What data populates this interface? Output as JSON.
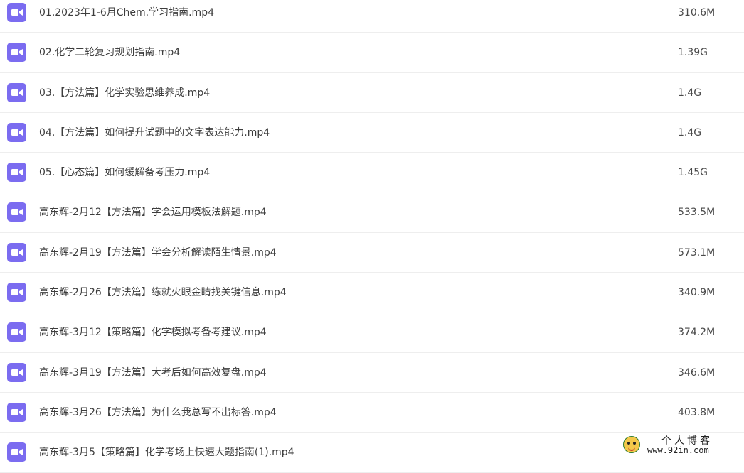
{
  "files": [
    {
      "name": "01.2023年1-6月Chem.学习指南.mp4",
      "size": "310.6M",
      "icon": "video-file-icon"
    },
    {
      "name": "02.化学二轮复习规划指南.mp4",
      "size": "1.39G",
      "icon": "video-file-icon"
    },
    {
      "name": "03.【方法篇】化学实验思维养成.mp4",
      "size": "1.4G",
      "icon": "video-file-icon"
    },
    {
      "name": "04.【方法篇】如何提升试题中的文字表达能力.mp4",
      "size": "1.4G",
      "icon": "video-file-icon"
    },
    {
      "name": "05.【心态篇】如何缓解备考压力.mp4",
      "size": "1.45G",
      "icon": "video-file-icon"
    },
    {
      "name": "高东辉-2月12【方法篇】学会运用模板法解题.mp4",
      "size": "533.5M",
      "icon": "video-file-icon"
    },
    {
      "name": "高东辉-2月19【方法篇】学会分析解读陌生情景.mp4",
      "size": "573.1M",
      "icon": "video-file-icon"
    },
    {
      "name": "高东辉-2月26【方法篇】练就火眼金睛找关键信息.mp4",
      "size": "340.9M",
      "icon": "video-file-icon"
    },
    {
      "name": "高东辉-3月12【策略篇】化学模拟考备考建议.mp4",
      "size": "374.2M",
      "icon": "video-file-icon"
    },
    {
      "name": "高东辉-3月19【方法篇】大考后如何高效复盘.mp4",
      "size": "346.6M",
      "icon": "video-file-icon"
    },
    {
      "name": "高东辉-3月26【方法篇】为什么我总写不出标答.mp4",
      "size": "403.8M",
      "icon": "video-file-icon"
    },
    {
      "name": "高东辉-3月5【策略篇】化学考场上快速大题指南(1).mp4",
      "size": "",
      "icon": "video-file-icon"
    }
  ],
  "watermark": {
    "title": "个人博客",
    "url": "www.92in.com"
  },
  "colors": {
    "icon_bg": "#7b6cf0",
    "row_divider": "#eeeeee",
    "text": "#3d3d3d"
  }
}
